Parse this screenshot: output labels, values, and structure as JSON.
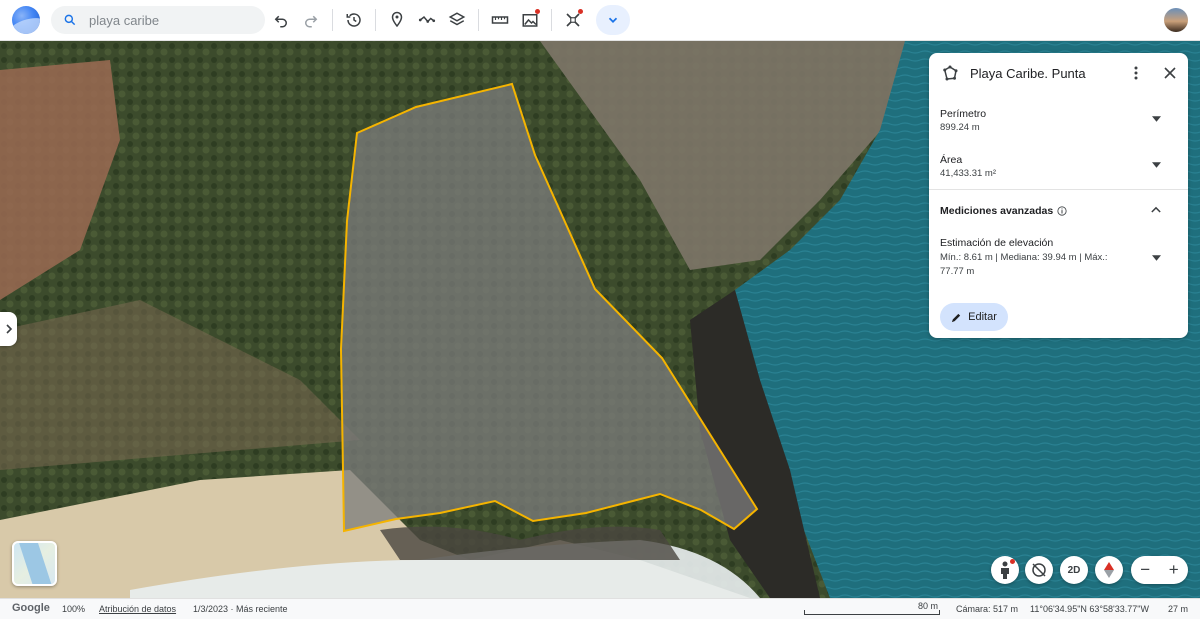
{
  "search": {
    "placeholder": "playa caribe"
  },
  "toolbar": {
    "items": [
      "undo-icon",
      "redo-icon",
      "history-icon",
      "pin-icon",
      "path-icon",
      "layers-icon",
      "ruler-icon",
      "image-icon",
      "projects-icon",
      "chevron-down-icon"
    ]
  },
  "panel": {
    "title": "Playa Caribe. Punta",
    "perimeter": {
      "label": "Perímetro",
      "value": "899.24 m"
    },
    "area": {
      "label": "Área",
      "value": "41,433.31 m²"
    },
    "advanced": {
      "label": "Mediciones avanzadas"
    },
    "elevation": {
      "label": "Estimación de elevación",
      "line1": "Mín.: 8.61 m | Mediana: 39.94 m | Máx.:",
      "line2": "77.77 m"
    },
    "edit_label": "Editar"
  },
  "controls": {
    "view_2d": "2D",
    "zoom_out": "−",
    "zoom_in": "+"
  },
  "status": {
    "brand": "Google",
    "zoom": "100%",
    "attribution": "Atribución de datos",
    "date": "1/3/2023 · Más reciente",
    "scale": "80 m",
    "camera": "Cámara: 517 m",
    "coords": "11°06'34.95\"N 63°58'33.77\"W",
    "elevation": "27 m"
  },
  "colors": {
    "polygon": "#f5b400",
    "accent": "#1a73e8",
    "edit_bg": "#d3e3fd"
  }
}
